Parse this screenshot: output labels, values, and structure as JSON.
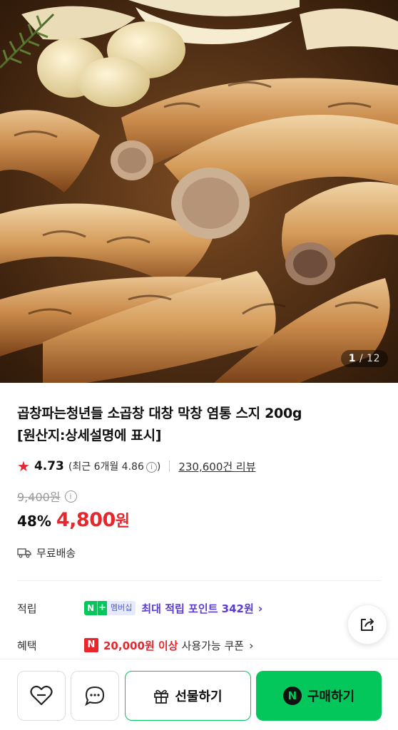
{
  "gallery": {
    "current": "1",
    "separator": "/",
    "total": "12"
  },
  "product": {
    "title_line1": "곱창파는청년들 소곱창 대창 막창 염통 스지 200g",
    "title_line2": "[원산지:상세설명에 표시]"
  },
  "rating": {
    "score": "4.73",
    "recent": "(최근 6개월 4.86",
    "info_glyph": "i",
    "recent_close": ")",
    "review_count": "230,600건 리뷰"
  },
  "price": {
    "original": "9,400원",
    "original_info": "i",
    "discount": "48%",
    "sale": "4,800",
    "currency": "원"
  },
  "shipping": {
    "label": "무료배송"
  },
  "benefits": {
    "points_label": "적립",
    "member_badge_n": "N",
    "member_badge_plus": "+",
    "member_badge_text": "멤버십",
    "points_text": "최대 적립 포인트 342원",
    "benefit_label": "혜택",
    "coupon_badge": "N",
    "coupon_amount": "20,000원 이상",
    "coupon_rest": "사용가능 쿠폰"
  },
  "bottom_bar": {
    "gift_label": "선물하기",
    "buy_badge": "N",
    "buy_label": "구매하기"
  },
  "icons": {
    "star": "star-icon",
    "share": "share-icon",
    "truck": "truck-icon",
    "like": "heart-icon",
    "talk": "chat-icon",
    "gift": "gift-icon"
  },
  "colors": {
    "accent_red": "#e8262c",
    "naver_green": "#03c75a",
    "points_purple": "#5a3bd6"
  }
}
